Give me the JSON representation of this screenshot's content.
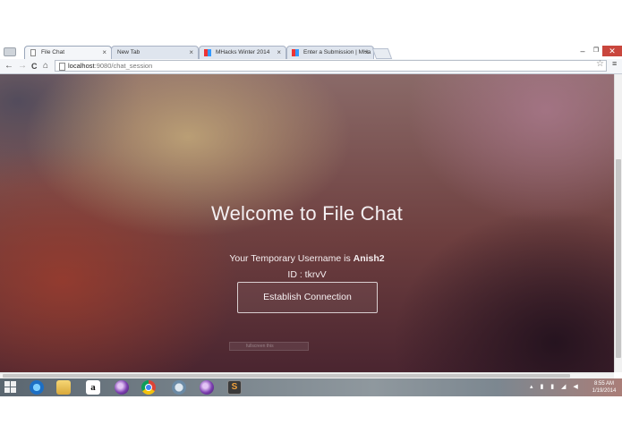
{
  "browser": {
    "tabs": [
      {
        "title": "File Chat",
        "active": true,
        "icon": "page-icon"
      },
      {
        "title": "New Tab",
        "active": false,
        "icon": "none"
      },
      {
        "title": "MHacks Winter 2014",
        "active": false,
        "icon": "mhacks-icon"
      },
      {
        "title": "Enter a Submission | MHa",
        "active": false,
        "icon": "mhacks-icon"
      }
    ],
    "tab_close_glyph": "×",
    "window_controls": {
      "minimize": "–",
      "restore": "❐",
      "close": "✕"
    },
    "nav": {
      "back": "←",
      "forward": "→",
      "reload": "C",
      "home": "⌂"
    },
    "url": {
      "host": "localhost",
      "path": ":9080/chat_session"
    },
    "bookmark_glyph": "☆",
    "menu_glyph": "≡"
  },
  "page": {
    "heading": "Welcome to File Chat",
    "username_prefix": "Your Temporary Username is ",
    "username": "Anish2",
    "id_line": "ID : tkrvV",
    "connect_label": "Establish Connection",
    "faint_text": "fullscreen this"
  },
  "taskbar": {
    "apps": [
      "ie-icon",
      "file-explorer-icon",
      "amazon-icon",
      "media-orb-icon",
      "chrome-icon",
      "tool-icon",
      "media-orb-icon",
      "sublime-text-icon"
    ],
    "amazon_glyph": "a",
    "sublime_glyph": "S",
    "time": "8:55 AM",
    "date": "1/19/2014"
  },
  "colors": {
    "close_button": "#c9463d",
    "text_on_bg": "#f4f0f2"
  }
}
